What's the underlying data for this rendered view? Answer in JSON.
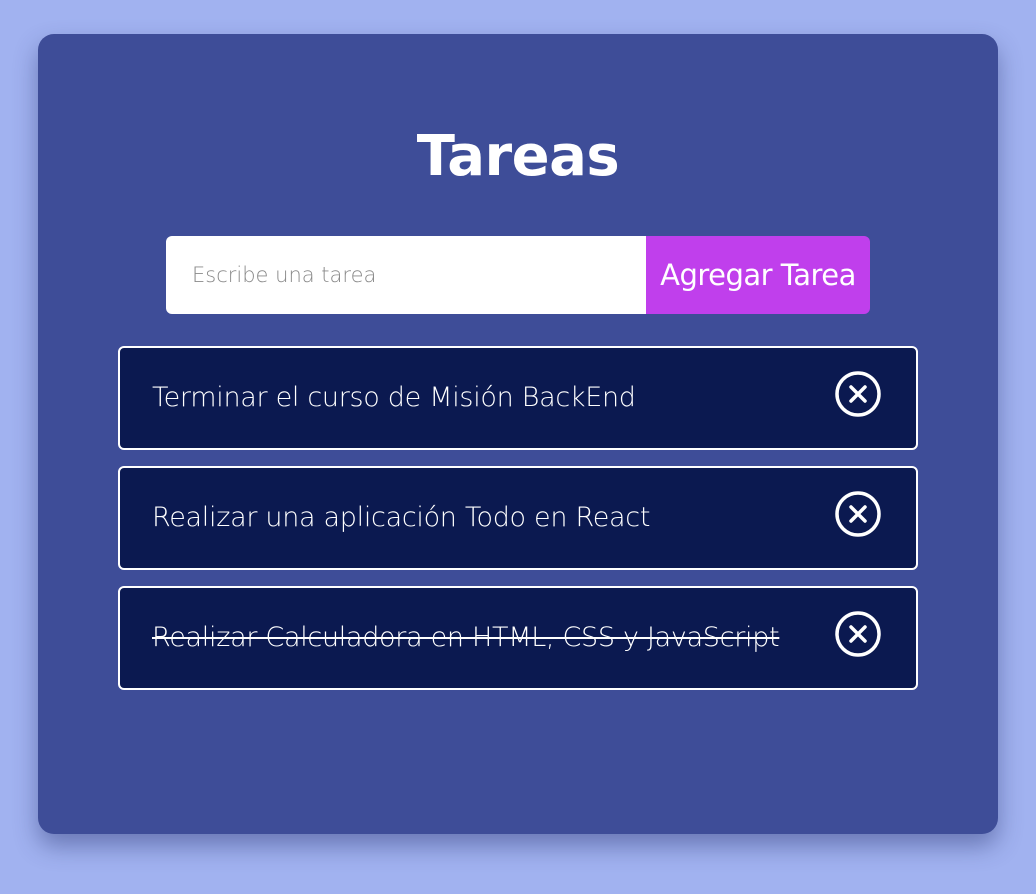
{
  "header": {
    "title": "Tareas"
  },
  "form": {
    "input_placeholder": "Escribe una tarea",
    "input_value": "",
    "add_button_label": "Agregar Tarea"
  },
  "tasks": [
    {
      "text": "Terminar el curso de Misión BackEnd",
      "completed": false,
      "delete_icon": "close-circle-icon"
    },
    {
      "text": "Realizar una aplicación Todo en React",
      "completed": false,
      "delete_icon": "close-circle-icon"
    },
    {
      "text": "Realizar Calculadora en HTML, CSS y JavaScript",
      "completed": true,
      "delete_icon": "close-circle-icon"
    }
  ],
  "colors": {
    "page_background": "#a1b2f0",
    "card_background": "#3e4d98",
    "task_background": "#0b1950",
    "accent_button": "#c03fec",
    "text": "#ffffff"
  }
}
